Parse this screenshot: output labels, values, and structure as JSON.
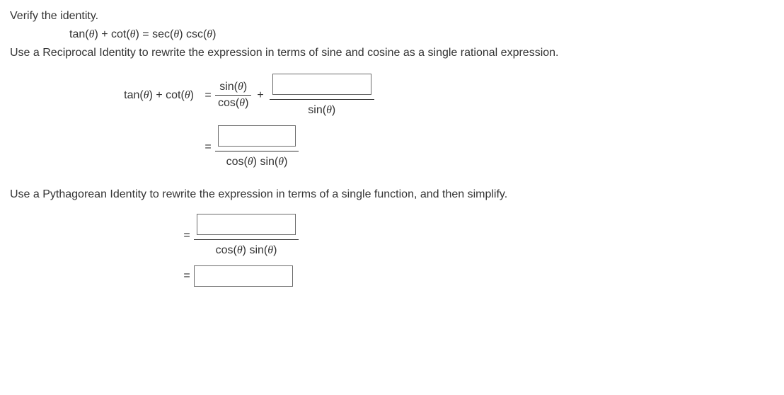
{
  "prompt": {
    "verify_line": "Verify the identity.",
    "identity_lhs_a": "tan(",
    "identity_lhs_b": ") + cot(",
    "identity_lhs_c": ") = sec(",
    "identity_lhs_d": ") csc(",
    "identity_lhs_e": ")",
    "instr1": "Use a Reciprocal Identity to rewrite the expression in terms of sine and cosine as a single rational expression.",
    "instr2": "Use a Pythagorean Identity to rewrite the expression in terms of a single function, and then simplify."
  },
  "step1": {
    "lhs_a": "tan(",
    "lhs_b": ") + cot(",
    "lhs_c": ")",
    "frac1_num_a": "sin(",
    "frac1_num_b": ")",
    "frac1_den_a": "cos(",
    "frac1_den_b": ")",
    "plus": "+",
    "frac2_den_a": "sin(",
    "frac2_den_b": ")"
  },
  "step2": {
    "den_a": "cos(",
    "den_b": ") sin(",
    "den_c": ")"
  },
  "step3": {
    "den_a": "cos(",
    "den_b": ") sin(",
    "den_c": ")"
  },
  "sym": {
    "theta": "θ",
    "eq": "="
  }
}
